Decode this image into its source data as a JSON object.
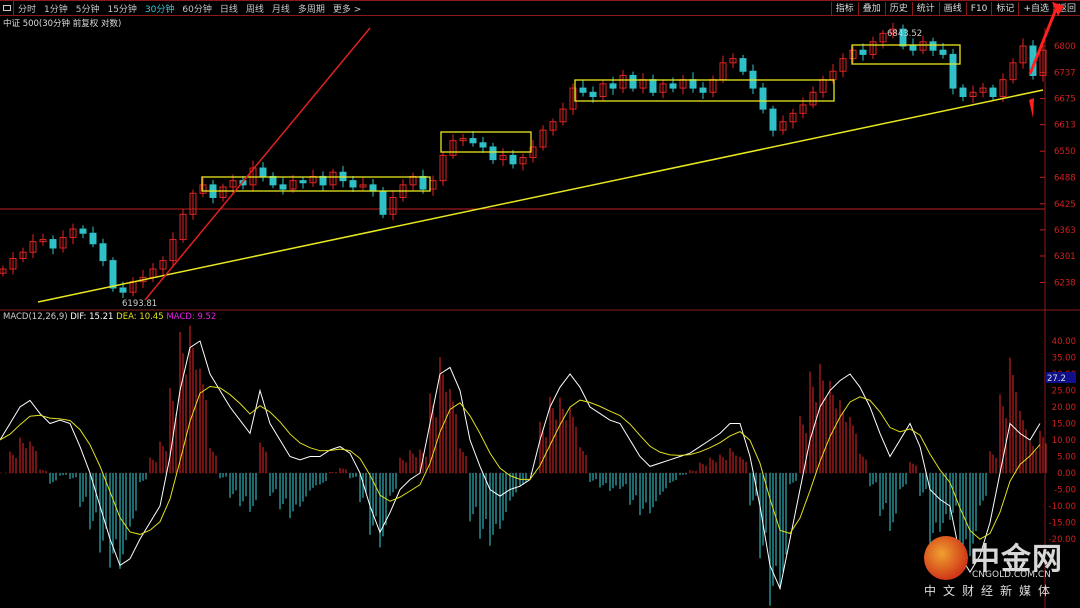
{
  "toolbar": {
    "periods": [
      "分时",
      "1分钟",
      "5分钟",
      "15分钟",
      "30分钟",
      "60分钟",
      "日线",
      "周线",
      "月线",
      "多周期",
      "更多 >"
    ],
    "active_period": "30分钟",
    "right": [
      "指标",
      "叠加",
      "历史",
      "统计",
      "画线",
      "F10",
      "标记",
      "+自选",
      "返回"
    ]
  },
  "title": "中证 500(30分钟 前复权 对数)",
  "macd": {
    "name": "MACD(12,26,9)",
    "dif": "DIF: 15.21",
    "dea": "DEA: 10.45",
    "macd": "MACD: 9.52",
    "cursor_value": "27.2"
  },
  "annotations": {
    "high": "6843.52",
    "low": "6193.81"
  },
  "logo": {
    "cn": "中金网",
    "en": "CNGOLD.COM.CN",
    "sub": "中文财经新媒体"
  },
  "colors": {
    "up": "#e02424",
    "down": "#30c0c8",
    "dif": "#ffffff",
    "dea": "#e0e020",
    "box": "#e8e820",
    "axis": "#d02020"
  },
  "chart_data": {
    "type": "candlestick",
    "price_axis_ticks": [
      6800,
      6737,
      6675,
      6613,
      6550,
      6488,
      6425,
      6363,
      6301,
      6238
    ],
    "macd_axis_ticks": [
      "40.00",
      "35.00",
      "30.00",
      "25.00",
      "20.00",
      "15.00",
      "10.00",
      "5.00",
      "0.00",
      "-5.00",
      "-10.00",
      "-15.00",
      "-20.00"
    ],
    "close": [
      6270,
      6295,
      6310,
      6335,
      6340,
      6320,
      6345,
      6365,
      6355,
      6330,
      6290,
      6225,
      6215,
      6240,
      6250,
      6270,
      6290,
      6340,
      6400,
      6450,
      6470,
      6440,
      6465,
      6480,
      6470,
      6510,
      6490,
      6470,
      6460,
      6480,
      6475,
      6490,
      6470,
      6500,
      6480,
      6465,
      6470,
      6455,
      6400,
      6440,
      6470,
      6490,
      6460,
      6480,
      6540,
      6575,
      6580,
      6570,
      6560,
      6530,
      6540,
      6520,
      6535,
      6560,
      6600,
      6620,
      6650,
      6700,
      6690,
      6680,
      6710,
      6700,
      6730,
      6700,
      6720,
      6690,
      6710,
      6700,
      6720,
      6700,
      6690,
      6720,
      6760,
      6770,
      6740,
      6700,
      6650,
      6600,
      6620,
      6640,
      6660,
      6690,
      6720,
      6740,
      6770,
      6790,
      6780,
      6810,
      6830,
      6840,
      6800,
      6790,
      6810,
      6790,
      6780,
      6700,
      6680,
      6690,
      6700,
      6680,
      6720,
      6760,
      6800,
      6730,
      6790
    ],
    "dif": [
      10,
      15,
      20,
      22,
      18,
      15,
      16,
      15,
      8,
      0,
      -10,
      -20,
      -28,
      -26,
      -20,
      -15,
      -10,
      5,
      25,
      38,
      40,
      30,
      25,
      20,
      16,
      12,
      25,
      15,
      10,
      5,
      4,
      5,
      5,
      7,
      8,
      6,
      0,
      -10,
      -18,
      -12,
      -5,
      -2,
      0,
      15,
      30,
      32,
      25,
      10,
      2,
      -5,
      -7,
      -5,
      -4,
      -2,
      10,
      20,
      26,
      30,
      26,
      20,
      18,
      16,
      15,
      10,
      5,
      2,
      3,
      4,
      5,
      6,
      8,
      10,
      12,
      15,
      15,
      5,
      -10,
      -28,
      -35,
      -20,
      -5,
      10,
      20,
      25,
      28,
      30,
      26,
      20,
      12,
      5,
      10,
      15,
      8,
      -5,
      -8,
      -10,
      -25,
      -30,
      -25,
      -15,
      0,
      15,
      12,
      10,
      15
    ]
  }
}
